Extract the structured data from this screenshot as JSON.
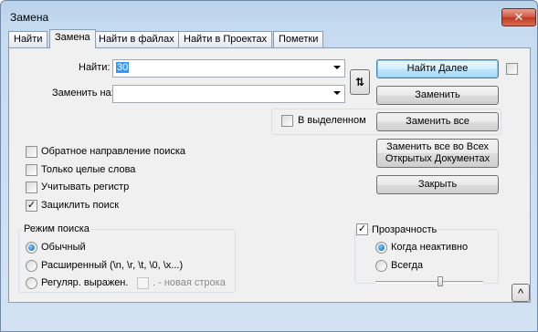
{
  "window": {
    "title": "Замена",
    "close_label": "✕"
  },
  "tabs": [
    "Найти",
    "Замена",
    "Найти в файлах",
    "Найти в Проектах",
    "Пометки"
  ],
  "find": {
    "label": "Найти:",
    "value": "30"
  },
  "replace": {
    "label": "Заменить на:",
    "value": ""
  },
  "swap_label": "⇅",
  "in_selection": {
    "label": "В выделенном",
    "checked": false
  },
  "buttons": {
    "find_next": "Найти Далее",
    "replace": "Заменить",
    "replace_all": "Заменить все",
    "replace_all_open_1": "Заменить все во Всех",
    "replace_all_open_2": "Открытых Документах",
    "close": "Закрыть",
    "collapse": "^"
  },
  "options": [
    {
      "label": "Обратное направление поиска",
      "checked": false
    },
    {
      "label": "Только целые слова",
      "checked": false
    },
    {
      "label": "Учитывать регистр",
      "checked": false
    },
    {
      "label": "Зациклить поиск",
      "checked": true
    }
  ],
  "search_mode": {
    "title": "Режим поиска",
    "normal": "Обычный",
    "extended": "Расширенный (\\n, \\r, \\t, \\0, \\x...)",
    "regex": "Регуляр. выражен.",
    "newline_label": ". - новая строка",
    "selected": "normal"
  },
  "transparency": {
    "label": "Прозрачность",
    "checked": true,
    "on_inactive": "Когда неактивно",
    "always": "Всегда",
    "selected": "on_inactive",
    "level": 0.6
  }
}
